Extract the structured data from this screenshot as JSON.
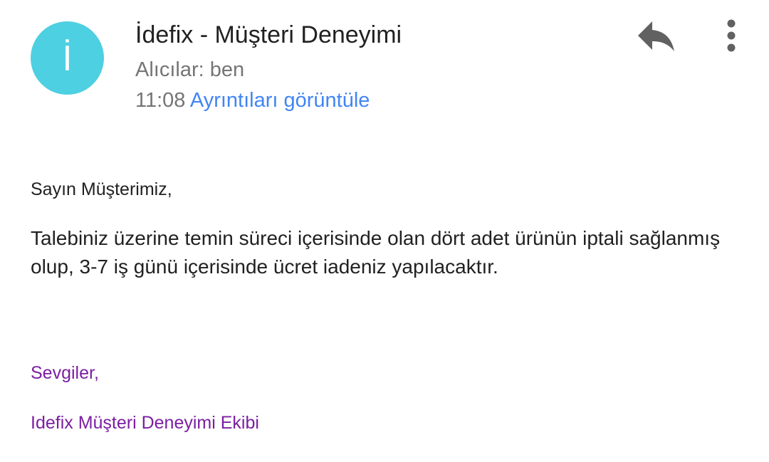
{
  "header": {
    "avatar_letter": "İ",
    "avatar_color": "#4dd0e1",
    "sender": "İdefix - Müşteri Deneyimi",
    "recipients": "Alıcılar: ben",
    "time": "11:08",
    "details_link": "Ayrıntıları görüntüle",
    "actions": {
      "reply_icon": "reply-icon",
      "more_icon": "more-vert-icon"
    }
  },
  "message": {
    "greeting": "Sayın Müşterimiz,",
    "body": "Talebiniz üzerine temin süreci içerisinde olan dört adet ürünün iptali sağlanmış olup, 3-7 iş günü içerisinde ücret iadeniz yapılacaktır.",
    "signoff": "Sevgiler,",
    "team": "Idefix Müşteri Deneyimi Ekibi"
  },
  "colors": {
    "link": "#4285f4",
    "signature": "#7b1fa2",
    "secondary_text": "#757575",
    "icon": "#616161"
  }
}
